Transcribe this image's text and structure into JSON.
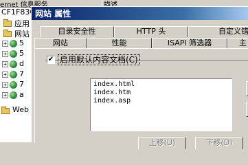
{
  "background_window": {
    "header_col1": "ernet 信息服务",
    "header_col2": "描述",
    "tree": {
      "computer": "CF1F83C",
      "items": [
        {
          "label": "应用",
          "kind": "folder"
        },
        {
          "label": "网站",
          "kind": "folder"
        },
        {
          "label": "5",
          "kind": "site"
        },
        {
          "label": "5",
          "kind": "site"
        },
        {
          "label": "d",
          "kind": "site"
        },
        {
          "label": "7",
          "kind": "site"
        },
        {
          "label": "7",
          "kind": "site"
        },
        {
          "label": "a",
          "kind": "site"
        },
        {
          "label": "Web",
          "kind": "folder"
        }
      ]
    }
  },
  "dialog": {
    "title": "网站 属性",
    "tabs_row1": [
      "目录安全性",
      "HTTP 头",
      "自定义错"
    ],
    "tabs_row2": [
      "网站",
      "性能",
      "ISAPI 筛选器",
      "主"
    ],
    "enable_default_doc": {
      "label": "启用默认内容文档(C)",
      "checked": true
    },
    "default_documents": [
      "index.html",
      "index.htm",
      "index.asp"
    ],
    "buttons": {
      "move_up": "上移(U)",
      "move_down": "下移(D)"
    }
  }
}
